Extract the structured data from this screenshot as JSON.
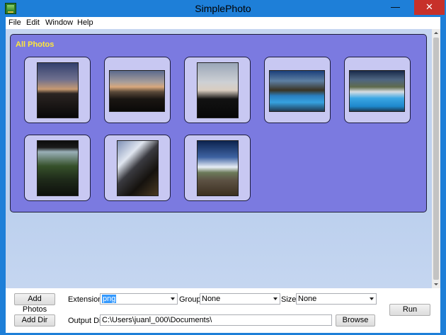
{
  "window": {
    "title": "SimplePhoto",
    "minimize_glyph": "—",
    "maximize_glyph": "☐",
    "close_glyph": "✕",
    "accent": "#1e7fd8",
    "close_color": "#c7312a"
  },
  "menu": {
    "items": [
      "File",
      "Edit",
      "Window",
      "Help"
    ]
  },
  "album": {
    "title": "All Photos",
    "background": "#7b7ae0",
    "title_color": "#ffe83a",
    "photos": [
      {
        "orientation": "portrait",
        "scene": "sunset sky over dark horizon"
      },
      {
        "orientation": "landscape",
        "scene": "sunset over hills"
      },
      {
        "orientation": "portrait",
        "scene": "silhouette of trees at dusk"
      },
      {
        "orientation": "landscape",
        "scene": "swimming pool with rocks"
      },
      {
        "orientation": "landscape",
        "scene": "swimming pool by hillside"
      },
      {
        "orientation": "portrait",
        "scene": "trees seen from under a roof"
      },
      {
        "orientation": "portrait",
        "scene": "hillside with light flare"
      },
      {
        "orientation": "portrait",
        "scene": "white building on road"
      }
    ]
  },
  "controls": {
    "add_photos_label": "Add Photos",
    "add_dir_label": "Add Dir",
    "extension_label": "Extension:",
    "extension_value": "png",
    "group_label": "Group:",
    "group_value": "None",
    "size_label": "Size:",
    "size_value": "None",
    "output_dir_label": "Output Dir:",
    "output_dir_value": "C:\\Users\\juanl_000\\Documents\\",
    "browse_label": "Browse",
    "run_label": "Run"
  }
}
